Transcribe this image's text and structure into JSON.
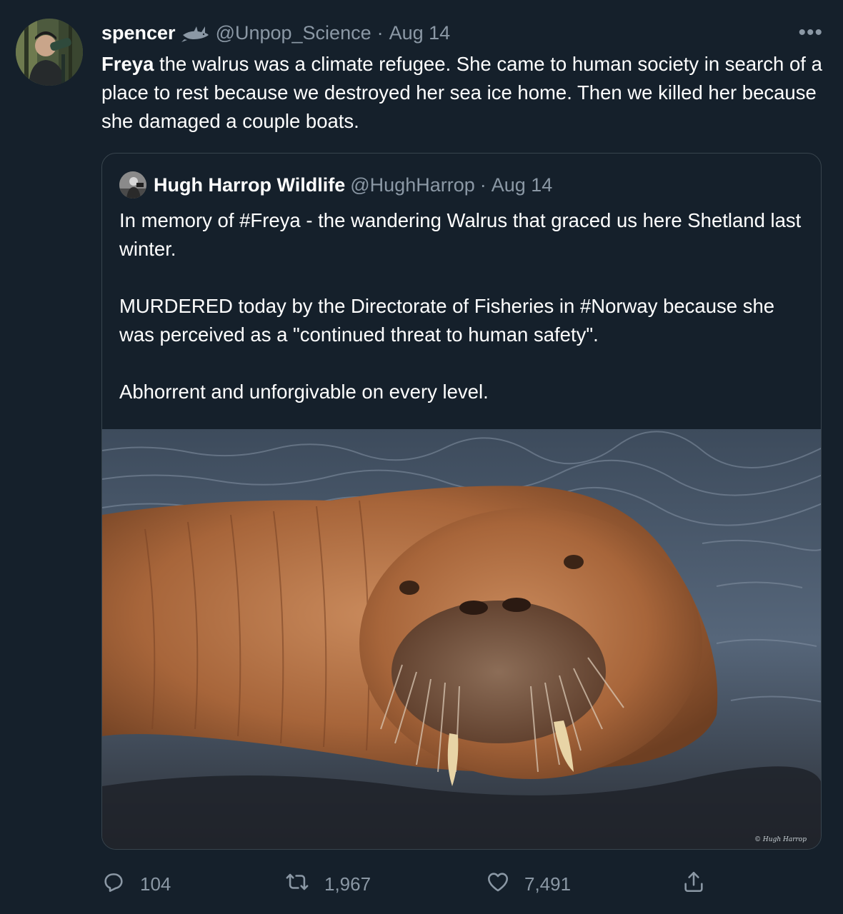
{
  "tweet": {
    "author_name": "spencer",
    "author_badge_icon": "shark-icon",
    "handle": "@Unpop_Science",
    "separator": "·",
    "date": "Aug 14",
    "more_label": "•••",
    "text_bold": "Freya",
    "text_rest": " the walrus was a climate refugee. She came to human society in search of a place to rest because we destroyed her sea ice home. Then we killed her because she damaged a couple boats."
  },
  "quote": {
    "author_name": "Hugh Harrop Wildlife",
    "handle": "@HughHarrop",
    "separator": "·",
    "date": "Aug 14",
    "paragraphs": [
      "In memory of #Freya - the wandering Walrus that graced us here Shetland last winter.",
      "MURDERED today by the Directorate of Fisheries in #Norway because she was perceived as a \"continued threat to human safety\".",
      "Abhorrent and unforgivable on every level."
    ],
    "photo_watermark": "© Hugh Harrop"
  },
  "actions": {
    "reply_count": "104",
    "retweet_count": "1,967",
    "like_count": "7,491"
  },
  "colors": {
    "background": "#15202b",
    "secondary_text": "#8b98a5",
    "border": "#38444d"
  }
}
